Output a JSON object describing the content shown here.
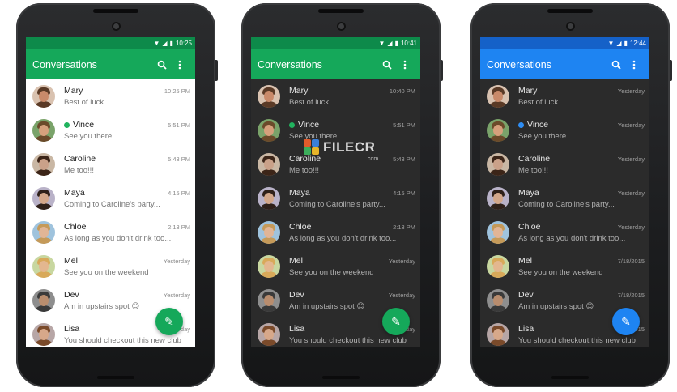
{
  "phones": [
    {
      "theme": "light",
      "status_time": "10:25",
      "title": "Conversations",
      "conversations": [
        {
          "name": "Mary",
          "preview": "Best of luck",
          "time": "10:25 PM",
          "online": false
        },
        {
          "name": "Vince",
          "preview": "See you there",
          "time": "5:51 PM",
          "online": true
        },
        {
          "name": "Caroline",
          "preview": "Me too!!!",
          "time": "5:43 PM",
          "online": false
        },
        {
          "name": "Maya",
          "preview": "Coming to Caroline's party...",
          "time": "4:15 PM",
          "online": false
        },
        {
          "name": "Chloe",
          "preview": "As long as you don't drink too...",
          "time": "2:13 PM",
          "online": false
        },
        {
          "name": "Mel",
          "preview": "See you on the weekend",
          "time": "Yesterday",
          "online": false
        },
        {
          "name": "Dev",
          "preview": "Am in upstairs spot 😊",
          "time": "Yesterday",
          "online": false
        },
        {
          "name": "Lisa",
          "preview": "You should checkout this new club",
          "time": "Yesterday",
          "online": false
        }
      ]
    },
    {
      "theme": "dark",
      "status_time": "10:41",
      "title": "Conversations",
      "conversations": [
        {
          "name": "Mary",
          "preview": "Best of luck",
          "time": "10:40 PM",
          "online": false
        },
        {
          "name": "Vince",
          "preview": "See you there",
          "time": "5:51 PM",
          "online": true
        },
        {
          "name": "Caroline",
          "preview": "Me too!!!",
          "time": "5:43 PM",
          "online": false
        },
        {
          "name": "Maya",
          "preview": "Coming to Caroline's party...",
          "time": "4:15 PM",
          "online": false
        },
        {
          "name": "Chloe",
          "preview": "As long as you don't drink too...",
          "time": "2:13 PM",
          "online": false
        },
        {
          "name": "Mel",
          "preview": "See you on the weekend",
          "time": "Yesterday",
          "online": false
        },
        {
          "name": "Dev",
          "preview": "Am in upstairs spot 😊",
          "time": "Yesterday",
          "online": false
        },
        {
          "name": "Lisa",
          "preview": "You should checkout this new club",
          "time": "Yesterday",
          "online": false
        }
      ]
    },
    {
      "theme": "blue",
      "status_time": "12:44",
      "title": "Conversations",
      "conversations": [
        {
          "name": "Mary",
          "preview": "Best of luck",
          "time": "Yesterday",
          "online": false
        },
        {
          "name": "Vince",
          "preview": "See you there",
          "time": "Yesterday",
          "online": true
        },
        {
          "name": "Caroline",
          "preview": "Me too!!!",
          "time": "Yesterday",
          "online": false
        },
        {
          "name": "Maya",
          "preview": "Coming to Caroline's party...",
          "time": "Yesterday",
          "online": false
        },
        {
          "name": "Chloe",
          "preview": "As long as you don't drink too...",
          "time": "Yesterday",
          "online": false
        },
        {
          "name": "Mel",
          "preview": "See you on the weekend",
          "time": "7/18/2015",
          "online": false
        },
        {
          "name": "Dev",
          "preview": "Am in upstairs spot 😊",
          "time": "7/18/2015",
          "online": false
        },
        {
          "name": "Lisa",
          "preview": "You should checkout this new club",
          "time": "7/18/2015",
          "online": false
        }
      ]
    }
  ],
  "icons": {
    "search": "search-icon",
    "overflow": "more-vert-icon",
    "fab": "pencil-icon",
    "wifi": "wifi-icon",
    "signal": "signal-icon",
    "battery": "battery-icon"
  },
  "colors": {
    "green_primary": "#15a85a",
    "green_dark": "#0d8a4a",
    "blue_primary": "#1e84f2",
    "blue_dark": "#1561c8",
    "online_green": "#21b35e",
    "online_blue": "#2e8ef5",
    "dark_background": "#2b2b2b"
  },
  "watermark": {
    "text": "FILECR",
    "sub": ".com"
  }
}
